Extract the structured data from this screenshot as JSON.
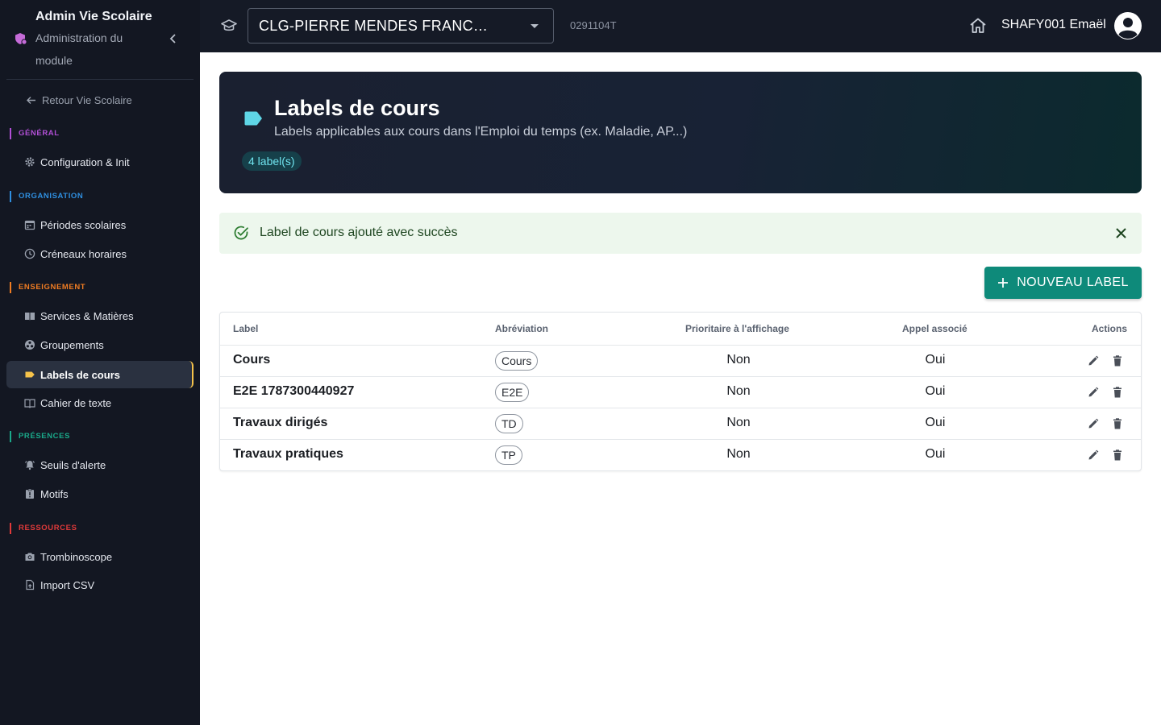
{
  "sidebar": {
    "title": "Admin Vie Scolaire",
    "subtitle": "Administration du module",
    "back_label": "Retour Vie Scolaire",
    "sections": {
      "general": {
        "label": "GÉNÉRAL",
        "color": "#b14fd6"
      },
      "organisation": {
        "label": "ORGANISATION",
        "color": "#2f8fe0"
      },
      "enseignement": {
        "label": "ENSEIGNEMENT",
        "color": "#f07c22"
      },
      "presences": {
        "label": "PRÉSENCES",
        "color": "#1aa98a"
      },
      "ressources": {
        "label": "RESSOURCES",
        "color": "#e03a3a"
      }
    },
    "items": {
      "config": "Configuration & Init",
      "periodes": "Périodes scolaires",
      "creneaux": "Créneaux horaires",
      "services": "Services & Matières",
      "groupements": "Groupements",
      "labels": "Labels de cours",
      "cahier": "Cahier de texte",
      "seuils": "Seuils d'alerte",
      "motifs": "Motifs",
      "trombi": "Trombinoscope",
      "import": "Import CSV"
    },
    "active_item": "labels"
  },
  "topbar": {
    "school_name": "CLG-PIERRE MENDES FRANC…",
    "uai": "0291104T",
    "user_name": "SHAFY001 Emaël"
  },
  "hero": {
    "title": "Labels de cours",
    "subtitle": "Labels applicables aux cours dans l'Emploi du temps (ex. Maladie, AP...)",
    "count_badge": "4 label(s)",
    "icon": "label-icon",
    "accent": "#5fd6e6"
  },
  "alert": {
    "message": "Label de cours ajouté avec succès",
    "type": "success"
  },
  "new_button_label": "NOUVEAU LABEL",
  "table": {
    "headers": {
      "label": "Label",
      "abbr": "Abréviation",
      "prio": "Prioritaire à l'affichage",
      "appel": "Appel associé",
      "actions": "Actions"
    },
    "rows": [
      {
        "label": "Cours",
        "abbr": "Cours",
        "prio": "Non",
        "appel": "Oui"
      },
      {
        "label": "E2E 1787300440927",
        "abbr": "E2E",
        "prio": "Non",
        "appel": "Oui"
      },
      {
        "label": "Travaux dirigés",
        "abbr": "TD",
        "prio": "Non",
        "appel": "Oui"
      },
      {
        "label": "Travaux pratiques",
        "abbr": "TP",
        "prio": "Non",
        "appel": "Oui"
      }
    ]
  }
}
